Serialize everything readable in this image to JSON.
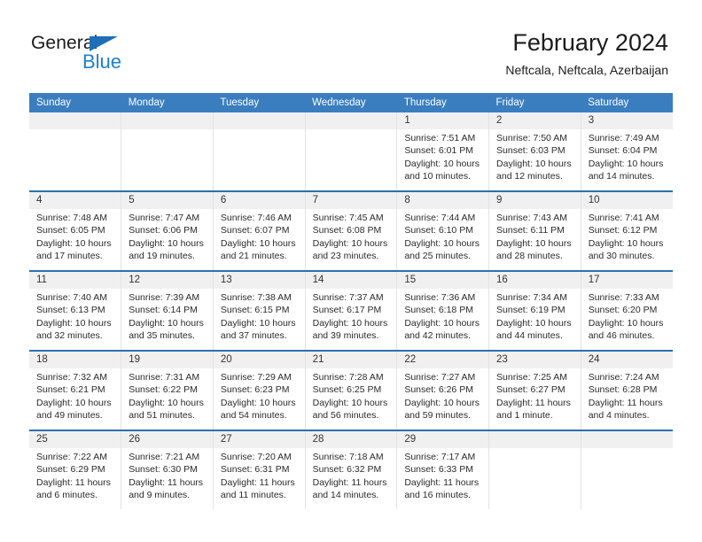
{
  "logo": {
    "word_one": "General",
    "word_two": "Blue",
    "triangle_color": "#1e6fb8",
    "blue_color": "#1e7fd0"
  },
  "header": {
    "title": "February 2024",
    "subtitle": "Neftcala, Neftcala, Azerbaijan"
  },
  "theme": {
    "header_blue": "#3a7ebf",
    "rule_blue": "#2f6fae",
    "band_gray": "#f0f0f0"
  },
  "weekdays": [
    "Sunday",
    "Monday",
    "Tuesday",
    "Wednesday",
    "Thursday",
    "Friday",
    "Saturday"
  ],
  "weeks": [
    [
      {
        "day": "",
        "lines": []
      },
      {
        "day": "",
        "lines": []
      },
      {
        "day": "",
        "lines": []
      },
      {
        "day": "",
        "lines": []
      },
      {
        "day": "1",
        "lines": [
          "Sunrise: 7:51 AM",
          "Sunset: 6:01 PM",
          "Daylight: 10 hours",
          "and 10 minutes."
        ]
      },
      {
        "day": "2",
        "lines": [
          "Sunrise: 7:50 AM",
          "Sunset: 6:03 PM",
          "Daylight: 10 hours",
          "and 12 minutes."
        ]
      },
      {
        "day": "3",
        "lines": [
          "Sunrise: 7:49 AM",
          "Sunset: 6:04 PM",
          "Daylight: 10 hours",
          "and 14 minutes."
        ]
      }
    ],
    [
      {
        "day": "4",
        "lines": [
          "Sunrise: 7:48 AM",
          "Sunset: 6:05 PM",
          "Daylight: 10 hours",
          "and 17 minutes."
        ]
      },
      {
        "day": "5",
        "lines": [
          "Sunrise: 7:47 AM",
          "Sunset: 6:06 PM",
          "Daylight: 10 hours",
          "and 19 minutes."
        ]
      },
      {
        "day": "6",
        "lines": [
          "Sunrise: 7:46 AM",
          "Sunset: 6:07 PM",
          "Daylight: 10 hours",
          "and 21 minutes."
        ]
      },
      {
        "day": "7",
        "lines": [
          "Sunrise: 7:45 AM",
          "Sunset: 6:08 PM",
          "Daylight: 10 hours",
          "and 23 minutes."
        ]
      },
      {
        "day": "8",
        "lines": [
          "Sunrise: 7:44 AM",
          "Sunset: 6:10 PM",
          "Daylight: 10 hours",
          "and 25 minutes."
        ]
      },
      {
        "day": "9",
        "lines": [
          "Sunrise: 7:43 AM",
          "Sunset: 6:11 PM",
          "Daylight: 10 hours",
          "and 28 minutes."
        ]
      },
      {
        "day": "10",
        "lines": [
          "Sunrise: 7:41 AM",
          "Sunset: 6:12 PM",
          "Daylight: 10 hours",
          "and 30 minutes."
        ]
      }
    ],
    [
      {
        "day": "11",
        "lines": [
          "Sunrise: 7:40 AM",
          "Sunset: 6:13 PM",
          "Daylight: 10 hours",
          "and 32 minutes."
        ]
      },
      {
        "day": "12",
        "lines": [
          "Sunrise: 7:39 AM",
          "Sunset: 6:14 PM",
          "Daylight: 10 hours",
          "and 35 minutes."
        ]
      },
      {
        "day": "13",
        "lines": [
          "Sunrise: 7:38 AM",
          "Sunset: 6:15 PM",
          "Daylight: 10 hours",
          "and 37 minutes."
        ]
      },
      {
        "day": "14",
        "lines": [
          "Sunrise: 7:37 AM",
          "Sunset: 6:17 PM",
          "Daylight: 10 hours",
          "and 39 minutes."
        ]
      },
      {
        "day": "15",
        "lines": [
          "Sunrise: 7:36 AM",
          "Sunset: 6:18 PM",
          "Daylight: 10 hours",
          "and 42 minutes."
        ]
      },
      {
        "day": "16",
        "lines": [
          "Sunrise: 7:34 AM",
          "Sunset: 6:19 PM",
          "Daylight: 10 hours",
          "and 44 minutes."
        ]
      },
      {
        "day": "17",
        "lines": [
          "Sunrise: 7:33 AM",
          "Sunset: 6:20 PM",
          "Daylight: 10 hours",
          "and 46 minutes."
        ]
      }
    ],
    [
      {
        "day": "18",
        "lines": [
          "Sunrise: 7:32 AM",
          "Sunset: 6:21 PM",
          "Daylight: 10 hours",
          "and 49 minutes."
        ]
      },
      {
        "day": "19",
        "lines": [
          "Sunrise: 7:31 AM",
          "Sunset: 6:22 PM",
          "Daylight: 10 hours",
          "and 51 minutes."
        ]
      },
      {
        "day": "20",
        "lines": [
          "Sunrise: 7:29 AM",
          "Sunset: 6:23 PM",
          "Daylight: 10 hours",
          "and 54 minutes."
        ]
      },
      {
        "day": "21",
        "lines": [
          "Sunrise: 7:28 AM",
          "Sunset: 6:25 PM",
          "Daylight: 10 hours",
          "and 56 minutes."
        ]
      },
      {
        "day": "22",
        "lines": [
          "Sunrise: 7:27 AM",
          "Sunset: 6:26 PM",
          "Daylight: 10 hours",
          "and 59 minutes."
        ]
      },
      {
        "day": "23",
        "lines": [
          "Sunrise: 7:25 AM",
          "Sunset: 6:27 PM",
          "Daylight: 11 hours",
          "and 1 minute."
        ]
      },
      {
        "day": "24",
        "lines": [
          "Sunrise: 7:24 AM",
          "Sunset: 6:28 PM",
          "Daylight: 11 hours",
          "and 4 minutes."
        ]
      }
    ],
    [
      {
        "day": "25",
        "lines": [
          "Sunrise: 7:22 AM",
          "Sunset: 6:29 PM",
          "Daylight: 11 hours",
          "and 6 minutes."
        ]
      },
      {
        "day": "26",
        "lines": [
          "Sunrise: 7:21 AM",
          "Sunset: 6:30 PM",
          "Daylight: 11 hours",
          "and 9 minutes."
        ]
      },
      {
        "day": "27",
        "lines": [
          "Sunrise: 7:20 AM",
          "Sunset: 6:31 PM",
          "Daylight: 11 hours",
          "and 11 minutes."
        ]
      },
      {
        "day": "28",
        "lines": [
          "Sunrise: 7:18 AM",
          "Sunset: 6:32 PM",
          "Daylight: 11 hours",
          "and 14 minutes."
        ]
      },
      {
        "day": "29",
        "lines": [
          "Sunrise: 7:17 AM",
          "Sunset: 6:33 PM",
          "Daylight: 11 hours",
          "and 16 minutes."
        ]
      },
      {
        "day": "",
        "lines": []
      },
      {
        "day": "",
        "lines": []
      }
    ]
  ]
}
